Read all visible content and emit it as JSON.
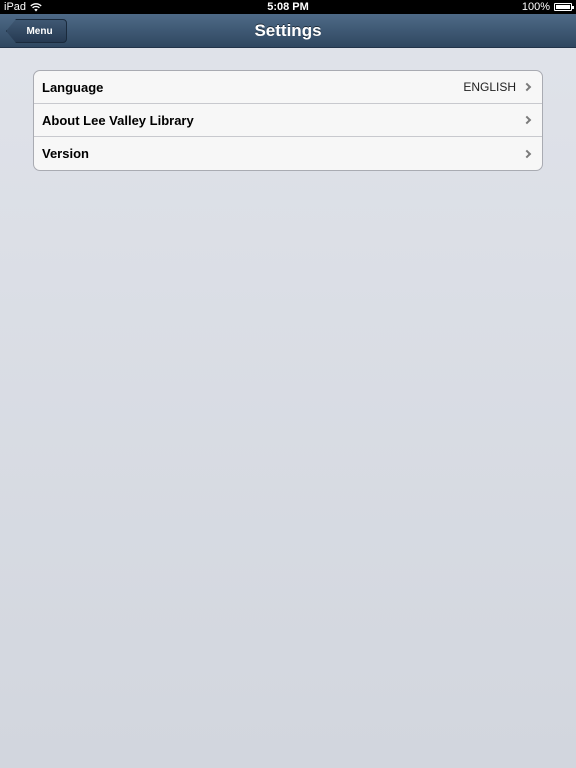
{
  "status_bar": {
    "device": "iPad",
    "time": "5:08 PM",
    "battery": "100%",
    "wifi_icon": "wifi-icon",
    "battery_level": 1.0
  },
  "nav_bar": {
    "title": "Settings",
    "back_label": "Menu"
  },
  "settings": {
    "rows": [
      {
        "label": "Language",
        "value": "ENGLISH"
      },
      {
        "label": "About Lee Valley Library",
        "value": ""
      },
      {
        "label": "Version",
        "value": ""
      }
    ]
  },
  "colors": {
    "nav_bar": "#3f5873",
    "background": "#d9dce3"
  }
}
